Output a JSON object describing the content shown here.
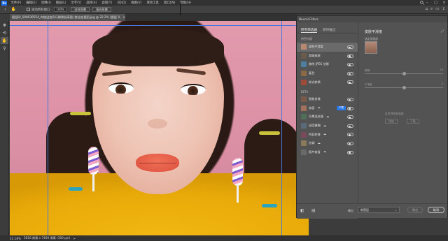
{
  "app": {
    "logo": "Ps",
    "menu": [
      "文件(F)",
      "编辑(E)",
      "图像(I)",
      "图层(L)",
      "文字(Y)",
      "选择(S)",
      "滤镜(T)",
      "3D(D)",
      "视图(V)",
      "增效工具",
      "窗口(W)",
      "帮助(H)"
    ]
  },
  "options_bar": {
    "check_label": "滚动所有窗口",
    "zoom_value": "100%",
    "fit_screen": "适合屏幕",
    "fill_screen": "填充屏幕"
  },
  "document": {
    "tab_title": "图层印_500030554_布链出信同马格骨抗高图 (依店金星团.jpg @ 22.2% (图层 0, RGB/8)",
    "close": "×"
  },
  "status": {
    "zoom": "22.18%",
    "info": "5616 像素 x 7400 像素 (300 ppi)",
    "arrow": ">"
  },
  "neural_filters": {
    "window_title": "Neural Filters",
    "tabs": [
      "所有筛选器",
      "即将推出"
    ],
    "sections": [
      {
        "label": "特色内容",
        "items": [
          {
            "label": "皮肤平滑度",
            "active": true,
            "on": false,
            "thumb": "#b9896f"
          },
          {
            "label": "超级缩放",
            "active": false,
            "on": false,
            "thumb": "#6b5b4d"
          },
          {
            "label": "移除 JPEG 伪影",
            "active": false,
            "on": false,
            "thumb": "#4f7fa0"
          },
          {
            "label": "着色",
            "active": false,
            "on": false,
            "thumb": "#8a6a45"
          },
          {
            "label": "样式转换",
            "active": false,
            "on": false,
            "thumb": "#a04a3a"
          }
        ]
      },
      {
        "label": "BETA",
        "items": [
          {
            "label": "智能肖像",
            "active": false,
            "on": false,
            "cloud": false,
            "thumb": "#7a5a4a"
          },
          {
            "label": "妆容",
            "active": false,
            "on": false,
            "cloud": true,
            "badge": "下载",
            "thumb": "#a0705a"
          },
          {
            "label": "风景混合器",
            "active": false,
            "on": false,
            "cloud": true,
            "thumb": "#4f6f5a"
          },
          {
            "label": "深度模糊",
            "active": false,
            "on": false,
            "cloud": true,
            "thumb": "#5a6a7a"
          },
          {
            "label": "色彩转移",
            "active": false,
            "on": false,
            "cloud": true,
            "thumb": "#7a4a5a"
          },
          {
            "label": "协调",
            "active": false,
            "on": false,
            "cloud": true,
            "thumb": "#8a7a5a"
          },
          {
            "label": "照片恢复",
            "active": false,
            "on": false,
            "cloud": true,
            "thumb": "#6a6a6a"
          }
        ]
      }
    ],
    "detail": {
      "title": "皮肤平滑度",
      "subtitle": "选定的面部",
      "expand": "⤢",
      "sliders": [
        {
          "label": "模糊",
          "value": "50",
          "level": 0.5
        },
        {
          "label": "平滑度",
          "value": "0",
          "level": 0.5
        }
      ],
      "check_label": "应用到所有面部",
      "btn_a": "添加",
      "btn_b": "下载",
      "footer": {
        "output_label": "输出",
        "output_value": "新图层",
        "caret": "⌄",
        "ok": "确定",
        "cancel": "取消"
      }
    }
  },
  "colors": {
    "accent": "#2b78e4",
    "canvas_pink": "#db8fa4",
    "hoodie_yellow": "#e8aa08"
  }
}
